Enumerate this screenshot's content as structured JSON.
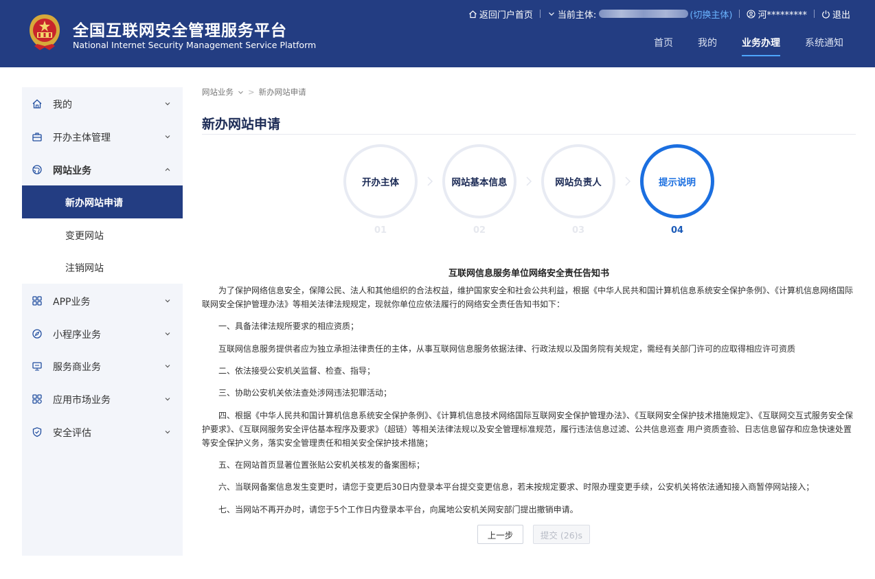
{
  "header": {
    "title": "全国互联网安全管理服务平台",
    "subtitle": "National Internet Security Management Service Platform",
    "portal_link": "返回门户首页",
    "entity_label": "当前主体:",
    "switch_label": "(切换主体)",
    "user_name": "河*********",
    "logout": "退出",
    "nav": [
      "首页",
      "我的",
      "业务办理",
      "系统通知"
    ],
    "active_nav": "业务办理",
    "bg_color": "#233d82",
    "accent_color": "#4ea6ff"
  },
  "sidebar": {
    "items": [
      {
        "label": "我的",
        "icon": "home-icon"
      },
      {
        "label": "开办主体管理",
        "icon": "briefcase-icon"
      },
      {
        "label": "网站业务",
        "icon": "globe-icon"
      },
      {
        "label": "APP业务",
        "icon": "grid-icon"
      },
      {
        "label": "小程序业务",
        "icon": "compass-icon"
      },
      {
        "label": "服务商业务",
        "icon": "monitor-icon"
      },
      {
        "label": "应用市场业务",
        "icon": "apps-icon"
      },
      {
        "label": "安全评估",
        "icon": "shield-check-icon"
      }
    ],
    "website_subitems": [
      "新办网站申请",
      "变更网站",
      "注销网站"
    ],
    "active_subitem": "新办网站申请"
  },
  "breadcrumb": {
    "parent": "网站业务",
    "current": "新办网站申请"
  },
  "page_title": "新办网站申请",
  "steps": [
    {
      "label": "开办主体",
      "num": "01"
    },
    {
      "label": "网站基本信息",
      "num": "02"
    },
    {
      "label": "网站负责人",
      "num": "03"
    },
    {
      "label": "提示说明",
      "num": "04"
    }
  ],
  "active_step": "04",
  "document": {
    "title": "互联网信息服务单位网络安全责任告知书",
    "paragraphs": [
      "为了保护网络信息安全，保障公民、法人和其他组织的合法权益，维护国家安全和社会公共利益，根据《中华人民共和国计算机信息系统安全保护条例》、《计算机信息网络国际联网安全保护管理办法》等相关法律法规规定，现就你单位应依法履行的网络安全责任告知书如下：",
      "一、具备法律法规所要求的相应资质；",
      "互联网信息服务提供者应为独立承担法律责任的主体，从事互联网信息服务依据法律、行政法规以及国务院有关规定，需经有关部门许可的应取得相应许可资质",
      "二、依法接受公安机关监督、检查、指导；",
      "三、协助公安机关依法查处涉网违法犯罪活动；",
      "四、根据《中华人民共和国计算机信息系统安全保护条例》、《计算机信息技术网络国际互联网安全保护管理办法》、《互联网安全保护技术措施规定》、《互联网交互式服务安全保护要求》、《互联网服务安全评估基本程序及要求》（超链）等相关法律法规以及安全管理标准规范，履行违法信息过滤、公共信息巡查 用户资质查验、日志信息留存和应急快速处置等安全保护义务，落实安全管理责任和相关安全保护技术措施；",
      "五、在网站首页显著位置张贴公安机关核发的备案图标；",
      "六、当联网备案信息发生变更时，请您于变更后30日内登录本平台提交变更信息，若未按规定要求、时限办理变更手续，公安机关将依法通知接入商暂停网站接入；",
      "七、当网站不再开办时，请您于5个工作日内登录本平台，向属地公安机关网安部门提出撤销申请。"
    ]
  },
  "buttons": {
    "prev": "上一步",
    "submit": "提交 (26)s"
  }
}
